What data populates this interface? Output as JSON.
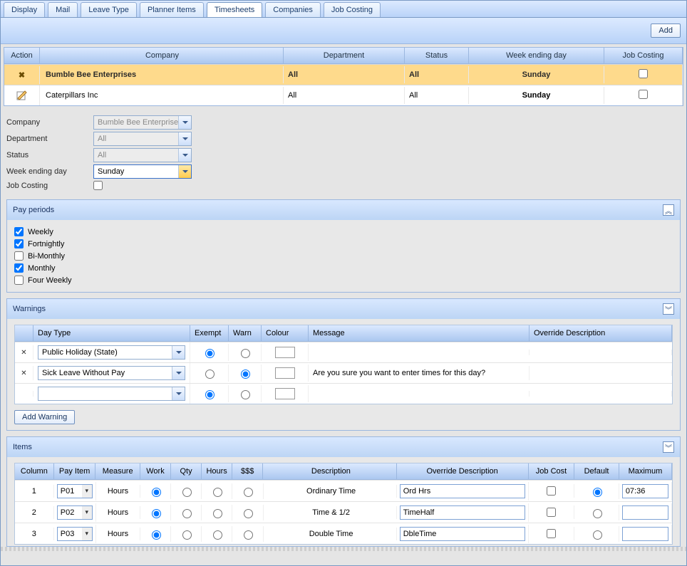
{
  "tabs": [
    "Display",
    "Mail",
    "Leave Type",
    "Planner Items",
    "Timesheets",
    "Companies",
    "Job Costing"
  ],
  "active_tab": 4,
  "add_button": "Add",
  "grid_headers": {
    "action": "Action",
    "company": "Company",
    "department": "Department",
    "status": "Status",
    "week": "Week ending day",
    "jc": "Job Costing"
  },
  "companies": [
    {
      "name": "Bumble Bee Enterprises",
      "dept": "All",
      "status": "All",
      "week": "Sunday",
      "jc": false,
      "selected": true,
      "icon": "delete"
    },
    {
      "name": "Caterpillars Inc",
      "dept": "All",
      "status": "All",
      "week": "Sunday",
      "jc": false,
      "selected": false,
      "icon": "edit"
    }
  ],
  "form": {
    "labels": {
      "company": "Company",
      "department": "Department",
      "status": "Status",
      "week": "Week ending day",
      "jc": "Job Costing"
    },
    "company": "Bumble Bee Enterprises",
    "department": "All",
    "status": "All",
    "week": "Sunday",
    "jc": false
  },
  "pay_periods": {
    "title": "Pay periods",
    "items": [
      {
        "label": "Weekly",
        "checked": true
      },
      {
        "label": "Fortnightly",
        "checked": true
      },
      {
        "label": "Bi-Monthly",
        "checked": false
      },
      {
        "label": "Monthly",
        "checked": true
      },
      {
        "label": "Four Weekly",
        "checked": false
      }
    ]
  },
  "warnings": {
    "title": "Warnings",
    "headers": {
      "day": "Day Type",
      "exempt": "Exempt",
      "warn": "Warn",
      "colour": "Colour",
      "msg": "Message",
      "ovr": "Override Description"
    },
    "rows": [
      {
        "day": "Public Holiday (State)",
        "exempt": true,
        "warn": false,
        "msg": "",
        "ovr": ""
      },
      {
        "day": "Sick Leave Without Pay",
        "exempt": false,
        "warn": true,
        "msg": "Are you sure you want to enter times for this day?",
        "ovr": ""
      },
      {
        "day": "",
        "exempt": true,
        "warn": false,
        "msg": "",
        "ovr": ""
      }
    ],
    "add_button": "Add Warning"
  },
  "items": {
    "title": "Items",
    "headers": {
      "col": "Column",
      "pi": "Pay Item",
      "meas": "Measure",
      "work": "Work",
      "qty": "Qty",
      "hours": "Hours",
      "money": "$$$",
      "desc": "Description",
      "ovr": "Override Description",
      "jc": "Job Cost",
      "def": "Default",
      "max": "Maximum"
    },
    "rows": [
      {
        "col": "1",
        "pi": "P01",
        "meas": "Hours",
        "radio": "work",
        "desc": "Ordinary Time",
        "ovr": "Ord Hrs",
        "jc": false,
        "def": true,
        "max": "07:36"
      },
      {
        "col": "2",
        "pi": "P02",
        "meas": "Hours",
        "radio": "work",
        "desc": "Time & 1/2",
        "ovr": "TimeHalf",
        "jc": false,
        "def": false,
        "max": ""
      },
      {
        "col": "3",
        "pi": "P03",
        "meas": "Hours",
        "radio": "work",
        "desc": "Double Time",
        "ovr": "DbleTime",
        "jc": false,
        "def": false,
        "max": ""
      }
    ]
  }
}
